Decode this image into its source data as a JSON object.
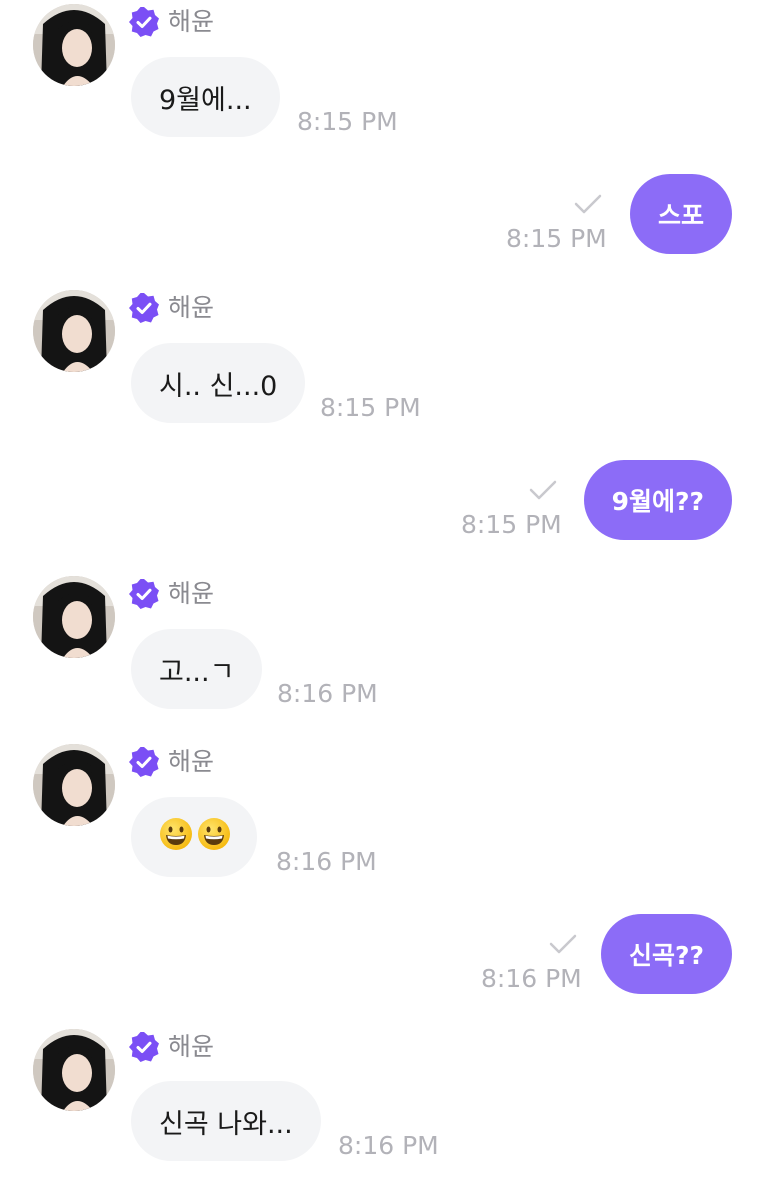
{
  "thread": {
    "sender_name": "해윤",
    "messages": [
      {
        "from": "artist",
        "text": "9월에...",
        "time": "8:15 PM"
      },
      {
        "from": "me",
        "text": "스포",
        "time": "8:15 PM"
      },
      {
        "from": "artist",
        "text": "시.. 신...0",
        "time": "8:15 PM"
      },
      {
        "from": "me",
        "text": "9월에??",
        "time": "8:15 PM"
      },
      {
        "from": "artist",
        "text": "고...ㄱ",
        "time": "8:16 PM"
      },
      {
        "from": "artist",
        "text": "😀😀",
        "time": "8:16 PM"
      },
      {
        "from": "me",
        "text": "신곡??",
        "time": "8:16 PM"
      },
      {
        "from": "artist",
        "text": "신곡 나와...",
        "time": "8:16 PM"
      }
    ]
  },
  "colors": {
    "outgoing_bubble": "#8c6cf7",
    "incoming_bubble": "#f3f4f6",
    "verified_badge": "#7b4ff5",
    "timestamp": "#b2b2b8",
    "sender_name": "#8a8a90"
  },
  "icons": {
    "verified": "verified-badge-icon",
    "read": "checkmark-icon"
  }
}
